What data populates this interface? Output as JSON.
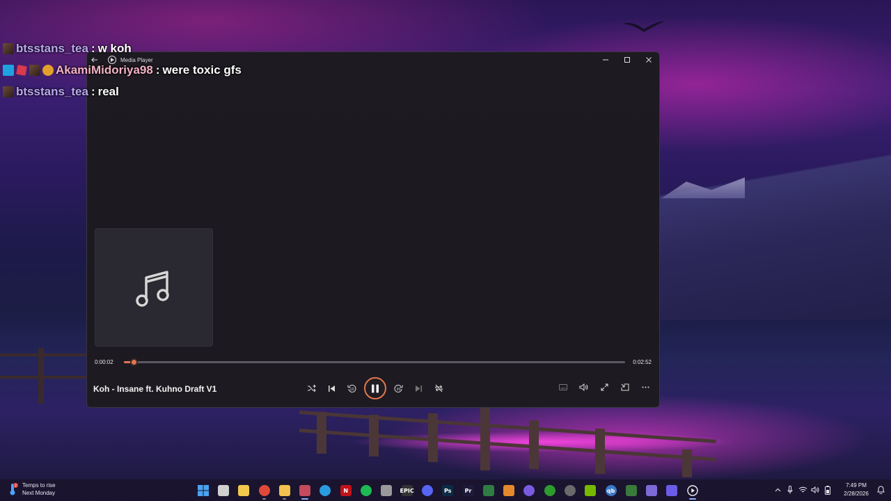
{
  "chat": [
    {
      "badges": [
        "brown"
      ],
      "user": "btsstans_tea",
      "separator": ":",
      "message": "w koh",
      "user_color": "#b9a8ef"
    },
    {
      "badges": [
        "blue",
        "red",
        "brown",
        "gold"
      ],
      "user": "AkamiMidoriya98",
      "separator": ":",
      "message": "were toxic gfs",
      "user_color": "#f3b2c4"
    },
    {
      "badges": [
        "brown"
      ],
      "user": "btsstans_tea",
      "separator": ":",
      "message": "real",
      "user_color": "#b9a8ef"
    }
  ],
  "window": {
    "title": "Media Player",
    "controls": [
      "minimize-icon",
      "maximize-icon",
      "close-icon"
    ]
  },
  "player": {
    "elapsed": "0:00:02",
    "total": "0:02:52",
    "progress_fraction": 0.019,
    "track_title": "Koh - Insane ft. Kuhno Draft V1",
    "state": "playing",
    "accent_color": "#e57352"
  },
  "taskbar": {
    "weather_line1": "Temps to rise",
    "weather_line2": "Next Monday",
    "weather_badge": "2",
    "clock_time": "7:49 PM",
    "clock_date": "2/28/2026",
    "apps": [
      {
        "name": "start-icon",
        "label": "",
        "color": "#4aa3f0",
        "state": ""
      },
      {
        "name": "task-view-icon",
        "label": "",
        "color": "#cfcfcf",
        "state": ""
      },
      {
        "name": "store-icon",
        "label": "",
        "color": "#f2c94c",
        "state": ""
      },
      {
        "name": "chrome-icon",
        "label": "",
        "color": "#e0493a",
        "state": "open"
      },
      {
        "name": "file-explorer-icon",
        "label": "",
        "color": "#f2c14e",
        "state": "open"
      },
      {
        "name": "steam-icon",
        "label": "",
        "color": "#c44a5e",
        "state": "active"
      },
      {
        "name": "edge-icon",
        "label": "",
        "color": "#2b9be0",
        "state": ""
      },
      {
        "name": "netflix-icon",
        "label": "N",
        "color": "#c11119",
        "state": ""
      },
      {
        "name": "spotify-icon",
        "label": "",
        "color": "#1db954",
        "state": ""
      },
      {
        "name": "extension-icon",
        "label": "",
        "color": "#9a9a9a",
        "state": ""
      },
      {
        "name": "epic-games-icon",
        "label": "EPIC",
        "color": "#333333",
        "state": ""
      },
      {
        "name": "discord-icon",
        "label": "",
        "color": "#5865f2",
        "state": ""
      },
      {
        "name": "photoshop-icon",
        "label": "Ps",
        "color": "#0d2b44",
        "state": ""
      },
      {
        "name": "premiere-icon",
        "label": "Pr",
        "color": "#1d1a3a",
        "state": ""
      },
      {
        "name": "stats-icon",
        "label": "",
        "color": "#2f7d43",
        "state": ""
      },
      {
        "name": "fl-studio-icon",
        "label": "",
        "color": "#e58a2c",
        "state": ""
      },
      {
        "name": "launcher-icon",
        "label": "",
        "color": "#7a5be0",
        "state": ""
      },
      {
        "name": "xbox-icon",
        "label": "",
        "color": "#2c9c2c",
        "state": ""
      },
      {
        "name": "obs-icon",
        "label": "",
        "color": "#6a6a6a",
        "state": ""
      },
      {
        "name": "nvidia-icon",
        "label": "",
        "color": "#76b900",
        "state": ""
      },
      {
        "name": "qbittorrent-icon",
        "label": "qb",
        "color": "#3b78c6",
        "state": ""
      },
      {
        "name": "game-icon",
        "label": "",
        "color": "#3a7a3a",
        "state": ""
      },
      {
        "name": "notes-icon",
        "label": "",
        "color": "#7d6ad6",
        "state": ""
      },
      {
        "name": "video-app-icon",
        "label": "",
        "color": "#6c5ce7",
        "state": ""
      },
      {
        "name": "media-player-icon",
        "label": "",
        "color": "#f1f1f1",
        "state": "active"
      }
    ]
  }
}
